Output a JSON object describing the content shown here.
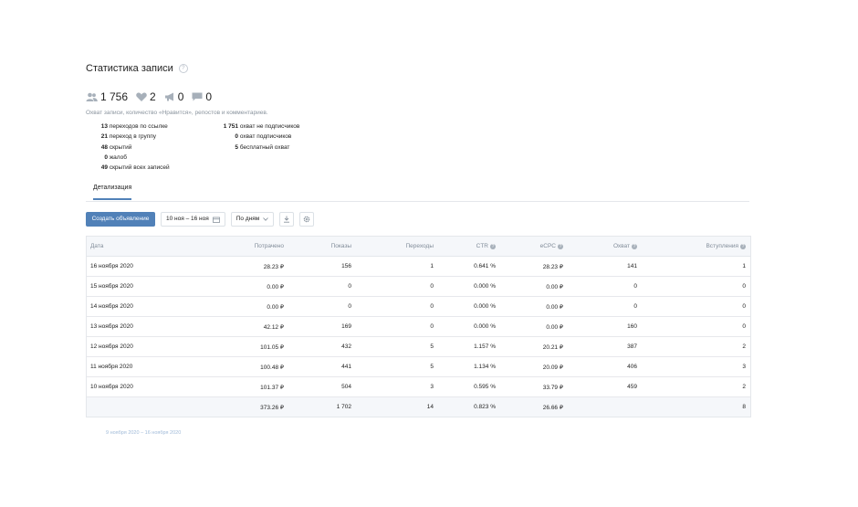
{
  "title": "Статистика записи",
  "help_icon": "question-circle-icon",
  "counters": [
    {
      "icon": "users-icon",
      "value": "1 756"
    },
    {
      "icon": "heart-icon",
      "value": "2"
    },
    {
      "icon": "megaphone-icon",
      "value": "0"
    },
    {
      "icon": "comment-icon",
      "value": "0"
    }
  ],
  "subtitle": "Охват записи, количество «Нравится», репостов и комментариев.",
  "breakdown_left": [
    {
      "num": "13",
      "label": "переходов по ссылке"
    },
    {
      "num": "21",
      "label": "переход в группу"
    },
    {
      "num": "48",
      "label": "скрытий"
    },
    {
      "num": "0",
      "label": "жалоб"
    },
    {
      "num": "49",
      "label": "скрытий всех записей"
    }
  ],
  "breakdown_right": [
    {
      "num": "1 751",
      "label": "охват не подписчиков"
    },
    {
      "num": "0",
      "label": "охват подписчиков"
    },
    {
      "num": "5",
      "label": "бесплатный охват"
    }
  ],
  "tabs": {
    "details": "Детализация"
  },
  "toolbar": {
    "create_ad": "Создать объявление",
    "date_range": "10 ноя – 16 ноя",
    "grouping": "По дням"
  },
  "table": {
    "headers": [
      "Дата",
      "Потрачено",
      "Показы",
      "Переходы",
      "CTR",
      "eCPC",
      "Охват",
      "Вступления"
    ],
    "rows": [
      [
        "16 ноября 2020",
        "28.23 ₽",
        "156",
        "1",
        "0.641 %",
        "28.23 ₽",
        "141",
        "1"
      ],
      [
        "15 ноября 2020",
        "0.00 ₽",
        "0",
        "0",
        "0.000 %",
        "0.00 ₽",
        "0",
        "0"
      ],
      [
        "14 ноября 2020",
        "0.00 ₽",
        "0",
        "0",
        "0.000 %",
        "0.00 ₽",
        "0",
        "0"
      ],
      [
        "13 ноября 2020",
        "42.12 ₽",
        "169",
        "0",
        "0.000 %",
        "0.00 ₽",
        "160",
        "0"
      ],
      [
        "12 ноября 2020",
        "101.05 ₽",
        "432",
        "5",
        "1.157 %",
        "20.21 ₽",
        "387",
        "2"
      ],
      [
        "11 ноября 2020",
        "100.48 ₽",
        "441",
        "5",
        "1.134 %",
        "20.09 ₽",
        "406",
        "3"
      ],
      [
        "10 ноября 2020",
        "101.37 ₽",
        "504",
        "3",
        "0.595 %",
        "33.79 ₽",
        "459",
        "2"
      ]
    ],
    "total": [
      "",
      "373.26 ₽",
      "1 702",
      "14",
      "0.823 %",
      "26.66 ₽",
      "",
      "8"
    ]
  },
  "footer_link": "9 ноября 2020 – 16 ноября 2020",
  "colors": {
    "accent": "#5181b8",
    "muted": "#818c99",
    "border": "#e4e7eb",
    "header_bg": "#f5f7fa"
  }
}
